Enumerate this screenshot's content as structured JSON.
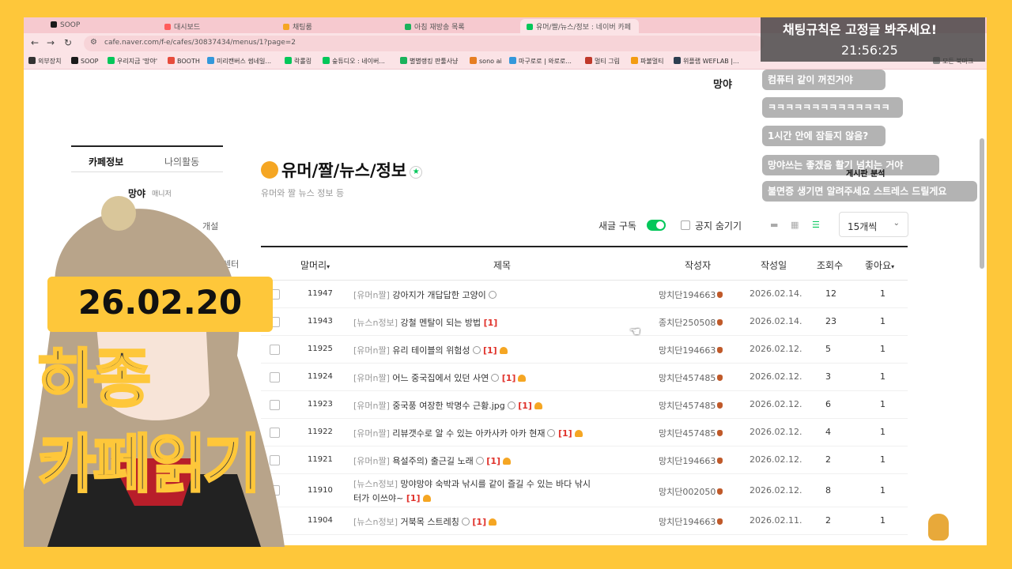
{
  "browser": {
    "tabs": [
      {
        "label": "SOOP",
        "color": "#1a1a1a",
        "active": false
      },
      {
        "label": "대시보드",
        "color": "#ff5c5c",
        "active": false
      },
      {
        "label": "채팅룸",
        "color": "#f5a623",
        "active": false
      },
      {
        "label": "아침 재방송 목록",
        "color": "#1ab25c",
        "active": false
      },
      {
        "label": "유머/짤/뉴스/정보 : 네이버 카페",
        "color": "#03c75a",
        "active": true
      }
    ],
    "url": "cafe.naver.com/f-e/cafes/30837434/menus/1?page=2",
    "bookmarks": [
      {
        "label": "외부장치",
        "color": "#333"
      },
      {
        "label": "SOOP",
        "color": "#1a1a1a"
      },
      {
        "label": "우리지금 '망야'",
        "color": "#03c75a"
      },
      {
        "label": "BOOTH",
        "color": "#e74c3c"
      },
      {
        "label": "미리캔버스 썸네일...",
        "color": "#3498db"
      },
      {
        "label": "락롤링",
        "color": "#03c75a"
      },
      {
        "label": "숲튜디오 : 네이버...",
        "color": "#03c75a"
      },
      {
        "label": "별별랭킹 판툴사냥",
        "color": "#1ab25c"
      },
      {
        "label": "sono ai",
        "color": "#e67e22"
      },
      {
        "label": "마구로로 | 와로로...",
        "color": "#3498db"
      },
      {
        "label": "멀티 그림",
        "color": "#c0392b"
      },
      {
        "label": "파불멀티",
        "color": "#f39c12"
      },
      {
        "label": "위플랩 WEFLAB |...",
        "color": "#2c3e50"
      },
      {
        "label": "모든 북마크",
        "color": "#888"
      }
    ]
  },
  "overlay": {
    "chat_title": "채팅규칙은 고정글 봐주세요!",
    "clock": "21:56:25",
    "messages": [
      "컴퓨터 같이 꺼진거야",
      "ㅋㅋㅋㅋㅋㅋㅋㅋㅋㅋㅋㅋㅋㅋ",
      "1시간 안에 잠들지 않음?",
      "망야쓰는 좋겠음 활기 넘치는 거야",
      "불면증 생기면 알려주세요 스트레스 드릴게요"
    ],
    "overlap_text": "게시판 분석",
    "corner_name": "망야"
  },
  "stream": {
    "date": "26.02.20",
    "title_line1": "하종",
    "title_line2": "카페읽기"
  },
  "sidebar": {
    "tab_info": "카페정보",
    "tab_activity": "나의활동",
    "manager_name": "망야",
    "manager_badge": "매니저",
    "open_text": "개설",
    "center_text": "센터"
  },
  "board": {
    "title": "유머/짤/뉴스/정보",
    "description": "유머와 짤 뉴스 정보 등",
    "subscribe_label": "새글 구독",
    "hide_notice_label": "공지 숨기기",
    "per_page": "15개씩",
    "columns": {
      "prefix": "말머리",
      "title": "제목",
      "author": "작성자",
      "date": "작성일",
      "views": "조회수",
      "likes": "좋아요"
    },
    "rows": [
      {
        "num": "11947",
        "tag": "[유머n짤]",
        "title": "강아지가 개답답한 고양이",
        "comments": "",
        "author": "망치단194663",
        "date": "2026.02.14.",
        "views": "12",
        "likes": "1"
      },
      {
        "num": "11943",
        "tag": "[뉴스n정보]",
        "title": "강철 멘탈이 되는 방법",
        "comments": "[1]",
        "author": "종치단250508",
        "date": "2026.02.14.",
        "views": "23",
        "likes": "1"
      },
      {
        "num": "11925",
        "tag": "[유머n짤]",
        "title": "유리 테이블의 위험성",
        "comments": "[1]",
        "author": "망치단194663",
        "date": "2026.02.12.",
        "views": "5",
        "likes": "1"
      },
      {
        "num": "11924",
        "tag": "[유머n짤]",
        "title": "어느 중국집에서 있던 사연",
        "comments": "[1]",
        "author": "망치단457485",
        "date": "2026.02.12.",
        "views": "3",
        "likes": "1"
      },
      {
        "num": "11923",
        "tag": "[유머n짤]",
        "title": "중국풍 여장한 박명수 근황.jpg",
        "comments": "[1]",
        "author": "망치단457485",
        "date": "2026.02.12.",
        "views": "6",
        "likes": "1"
      },
      {
        "num": "11922",
        "tag": "[유머n짤]",
        "title": "리뷰갯수로 알 수 있는 아카사카 아카 현재",
        "comments": "[1]",
        "author": "망치단457485",
        "date": "2026.02.12.",
        "views": "4",
        "likes": "1"
      },
      {
        "num": "11921",
        "tag": "[유머n짤]",
        "title": "욕설주의) 출근길 노래",
        "comments": "[1]",
        "author": "망치단194663",
        "date": "2026.02.12.",
        "views": "2",
        "likes": "1"
      },
      {
        "num": "11910",
        "tag": "[뉴스n정보]",
        "title": "망야망야 숙박과 낚시를 같이 즐길 수 있는 바다 낚시",
        "title2": "터가 이쓰야~",
        "comments": "[1]",
        "author": "망치단002050",
        "date": "2026.02.12.",
        "views": "8",
        "likes": "1"
      },
      {
        "num": "11904",
        "tag": "[뉴스n정보]",
        "title": "거북목 스트레칭",
        "comments": "[1]",
        "author": "망치단194663",
        "date": "2026.02.11.",
        "views": "2",
        "likes": "1"
      }
    ]
  }
}
